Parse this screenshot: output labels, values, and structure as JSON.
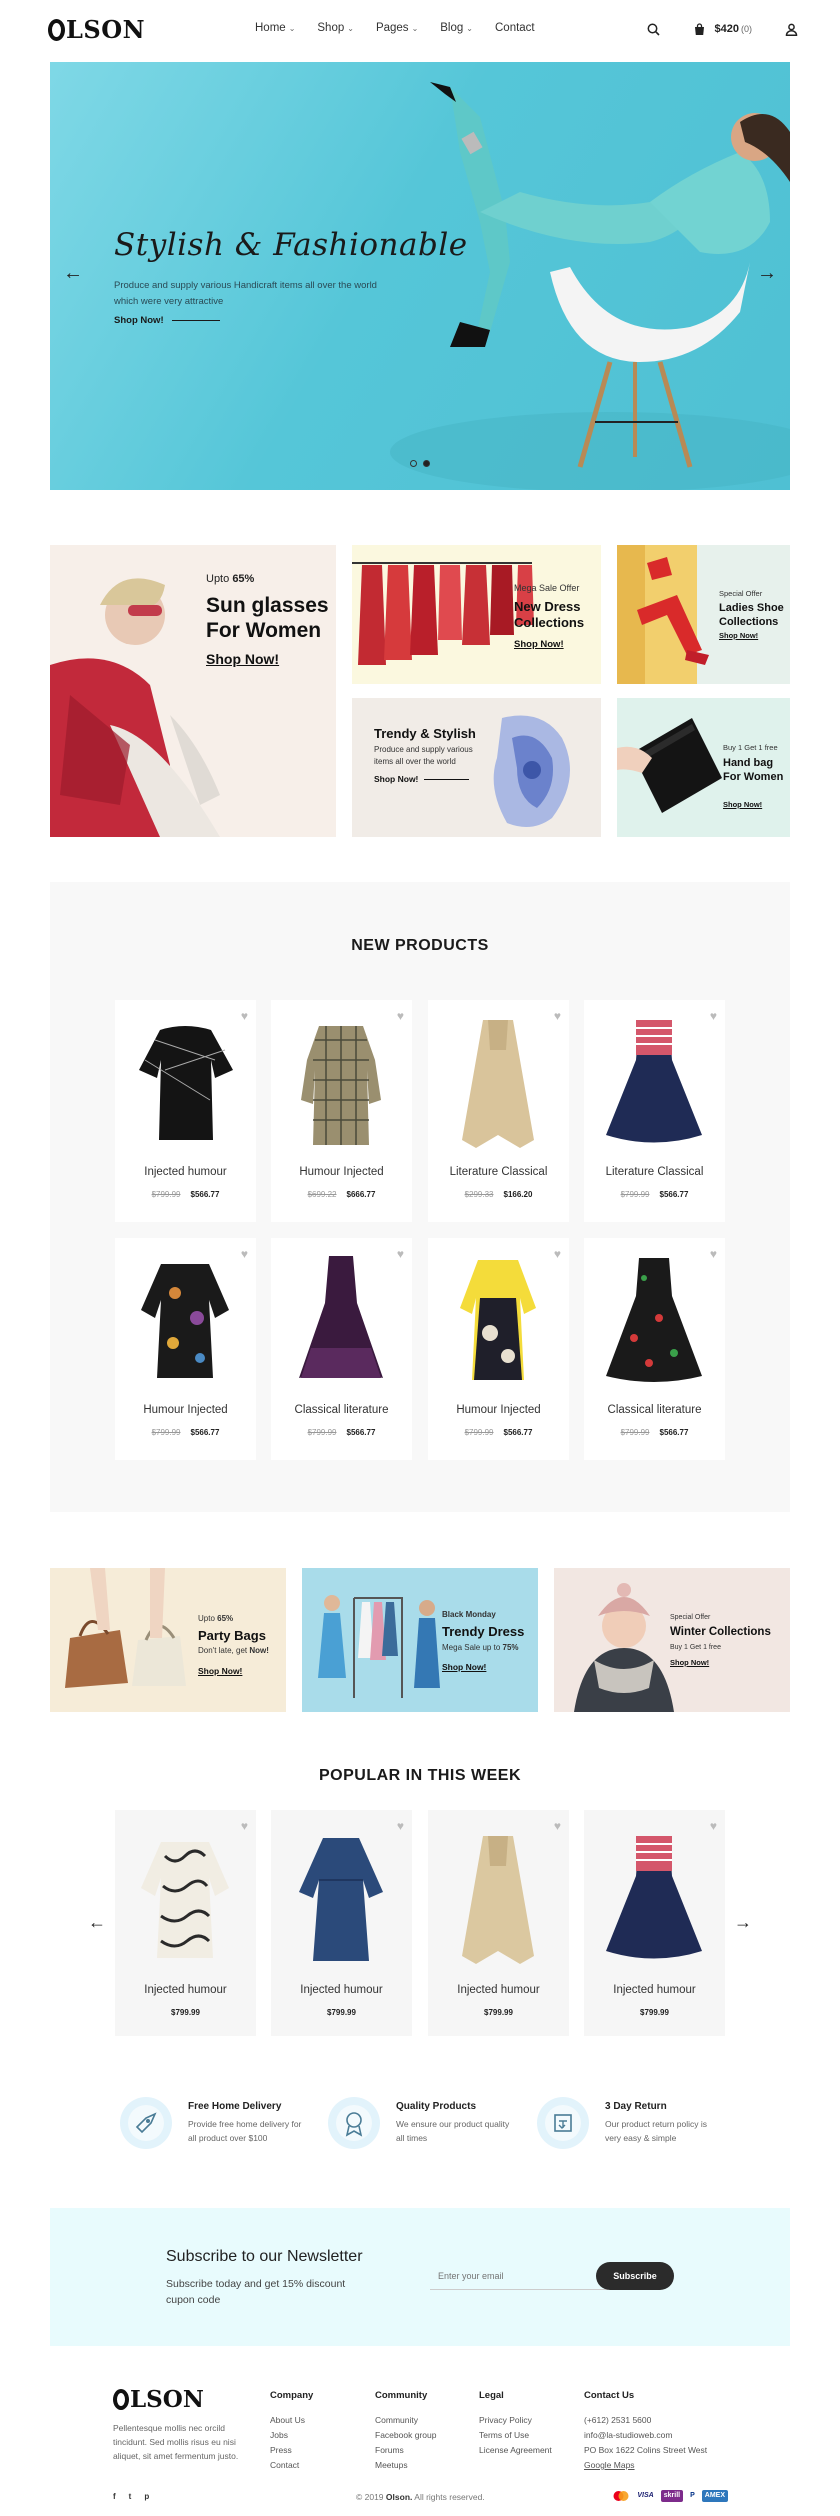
{
  "header": {
    "logo": "OLSON",
    "nav": [
      "Home",
      "Shop",
      "Pages",
      "Blog",
      "Contact"
    ],
    "nav_has_dropdown": [
      true,
      true,
      true,
      true,
      false
    ],
    "cart_amount": "$420",
    "cart_count": "(0)",
    "icons": [
      "search-icon",
      "cart-icon",
      "user-icon"
    ]
  },
  "hero": {
    "title": "Stylish & Fashionable",
    "subtitle": "Produce and supply various Handicraft items all over the world which were very attractive",
    "cta": "Shop Now!",
    "slide_count": 2,
    "active_slide": 2,
    "bg_color": "#55c6d8"
  },
  "promos": {
    "sunglasses": {
      "kicker": "Upto",
      "pct": "65%",
      "title": "Sun glasses For Women",
      "cta": "Shop Now!"
    },
    "dress": {
      "kicker": "Mega Sale Offer",
      "title": "New Dress Collections",
      "cta": "Shop Now!"
    },
    "shoe": {
      "kicker": "Special Offer",
      "title": "Ladies Shoe Collections",
      "cta": "Shop Now!"
    },
    "trendy": {
      "title": "Trendy & Stylish",
      "desc": "Produce and supply various items all over the world",
      "cta": "Shop Now!"
    },
    "handbag": {
      "kicker": "Buy 1 Get 1 free",
      "title": "Hand bag For Women",
      "cta": "Shop Now!"
    }
  },
  "new_products": {
    "title": "NEW PRODUCTS",
    "items": [
      {
        "name": "Injected humour",
        "old": "$799.99",
        "price": "$566.77"
      },
      {
        "name": "Humour Injected",
        "old": "$699.22",
        "price": "$666.77"
      },
      {
        "name": "Literature Classical",
        "old": "$299.33",
        "price": "$166.20"
      },
      {
        "name": "Literature Classical",
        "old": "$799.99",
        "price": "$566.77"
      },
      {
        "name": "Humour Injected",
        "old": "$799.99",
        "price": "$566.77"
      },
      {
        "name": "Classical literature",
        "old": "$799.99",
        "price": "$566.77"
      },
      {
        "name": "Humour Injected",
        "old": "$799.99",
        "price": "$566.77"
      },
      {
        "name": "Classical literature",
        "old": "$799.99",
        "price": "$566.77"
      }
    ]
  },
  "banners": {
    "bags": {
      "kicker": "Upto",
      "pct": "65%",
      "title": "Party Bags",
      "desc1": "Don't late, get",
      "desc2": "Now!",
      "cta": "Shop Now!"
    },
    "trendy_dress": {
      "kicker": "Black Monday",
      "title": "Trendy Dress",
      "desc1": "Mega Sale up to",
      "desc2": "75%",
      "cta": "Shop Now!"
    },
    "winter": {
      "kicker": "Special Offer",
      "title": "Winter Collections",
      "desc": "Buy 1 Get 1 free",
      "cta": "Shop Now!"
    }
  },
  "popular": {
    "title": "POPULAR IN THIS WEEK",
    "items": [
      {
        "name": "Injected humour",
        "price": "$799.99"
      },
      {
        "name": "Injected humour",
        "price": "$799.99"
      },
      {
        "name": "Injected humour",
        "price": "$799.99"
      },
      {
        "name": "Injected humour",
        "price": "$799.99"
      }
    ]
  },
  "features": [
    {
      "title": "Free Home Delivery",
      "desc": "Provide free home delivery for all product over $100",
      "icon": "delivery-icon"
    },
    {
      "title": "Quality Products",
      "desc": "We ensure our product quality all times",
      "icon": "quality-icon"
    },
    {
      "title": "3 Day Return",
      "desc": "Our product return policy is very easy & simple",
      "icon": "return-icon"
    }
  ],
  "newsletter": {
    "title": "Subscribe to our Newsletter",
    "subtitle": "Subscribe today and get 15% discount cupon code",
    "placeholder": "Enter your email",
    "button": "Subscribe"
  },
  "footer": {
    "logo": "OLSON",
    "desc": "Pellentesque mollis nec orcild tincidunt. Sed mollis risus eu nisi aliquet, sit amet fermentum justo.",
    "columns": [
      {
        "title": "Company",
        "links": [
          "About Us",
          "Jobs",
          "Press",
          "Contact"
        ]
      },
      {
        "title": "Community",
        "links": [
          "Community",
          "Facebook group",
          "Forums",
          "Meetups"
        ]
      },
      {
        "title": "Legal",
        "links": [
          "Privacy Policy",
          "Terms of Use",
          "License Agreement"
        ]
      },
      {
        "title": "Contact Us",
        "links": [
          "(+612) 2531 5600",
          "info@la-studioweb.com",
          "PO Box 1622 Colins Street West",
          "Google Maps"
        ]
      }
    ],
    "social": [
      "f",
      "t",
      "p"
    ],
    "copyright_pre": "© 2019",
    "copyright_brand": "Olson.",
    "copyright_post": "All rights reserved.",
    "payments": [
      "mastercard",
      "VISA",
      "skrill",
      "P",
      "AMEX"
    ]
  }
}
